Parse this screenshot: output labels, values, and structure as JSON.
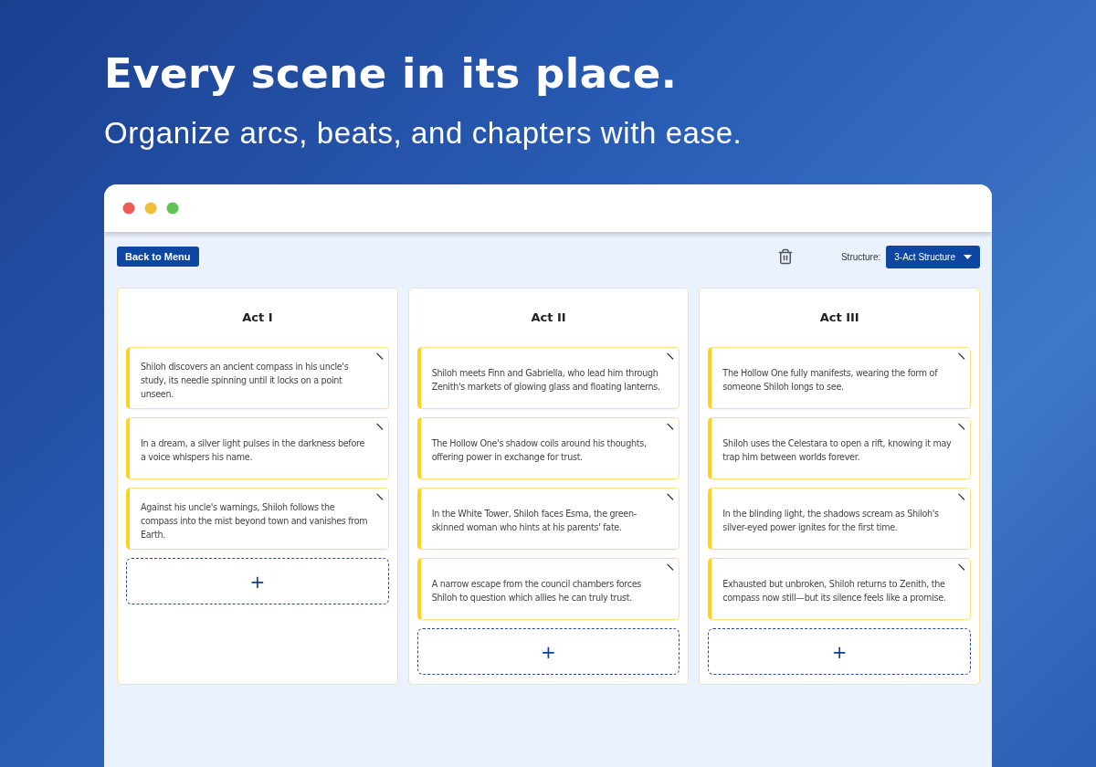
{
  "headline": "Every scene in its place.",
  "subheadline": "Organize arcs, beats, and chapters with ease.",
  "toolbar": {
    "back_button": "Back to Menu",
    "structure_label": "Structure:",
    "structure_value": "3-Act Structure"
  },
  "columns": [
    {
      "title": "Act I",
      "add_label": "+",
      "cards": [
        "Shiloh discovers an ancient compass in his uncle's study, its needle spinning until it locks on a point unseen.",
        "In a dream, a silver light pulses in the darkness before a voice whispers his name.",
        "Against his uncle's warnings, Shiloh follows the compass into the mist beyond town and vanishes from Earth."
      ]
    },
    {
      "title": "Act II",
      "add_label": "+",
      "cards": [
        "Shiloh meets Finn and Gabriella, who lead him through Zenith's markets of glowing glass and floating lanterns.",
        "The Hollow One's shadow coils around his thoughts, offering power in exchange for trust.",
        "In the White Tower, Shiloh faces Esma, the green-skinned woman who hints at his parents' fate.",
        "A narrow escape from the council chambers forces Shiloh to question which allies he can truly trust."
      ]
    },
    {
      "title": "Act III",
      "add_label": "+",
      "cards": [
        "The Hollow One fully manifests, wearing the form of someone Shiloh longs to see.",
        "Shiloh uses the Celestara to open a rift, knowing it may trap him between worlds forever.",
        "In the blinding light, the shadows scream as Shiloh's silver-eyed power ignites for the first time.",
        "Exhausted but unbroken, Shiloh returns to Zenith, the compass now still—but its silence feels like a promise."
      ]
    }
  ]
}
